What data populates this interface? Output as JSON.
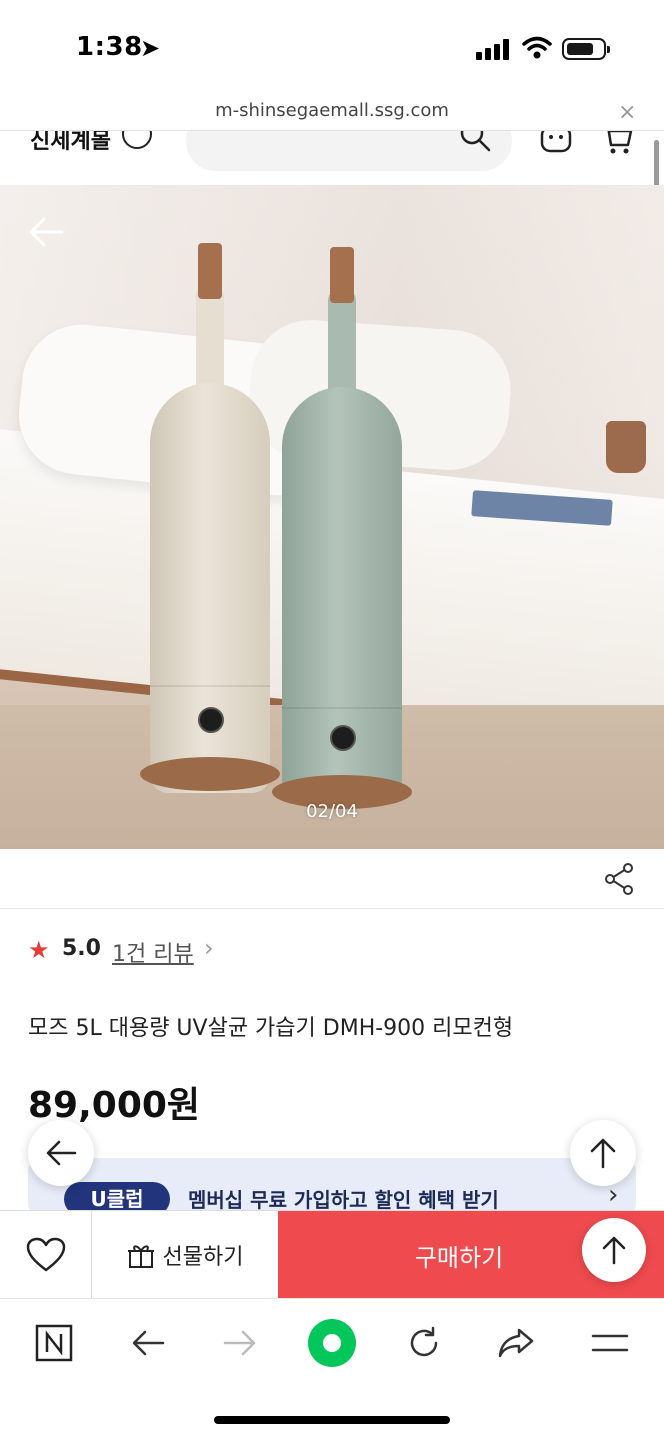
{
  "status_bar": {
    "time": "1:38"
  },
  "browser": {
    "url": "m-shinsegaemall.ssg.com",
    "close_label": "×"
  },
  "site_header": {
    "brand": "신세계몰"
  },
  "gallery": {
    "counter": "02/04"
  },
  "product": {
    "rating_star": "★",
    "rating": "5.0",
    "review_link": "1건 리뷰",
    "review_chevron": "›",
    "title": "모즈 5L 대용량 UV살균 가습기 DMH-900 리모컨형",
    "price": "89,000원"
  },
  "banner": {
    "badge": "U클럽",
    "text": "멤버십 무료 가입하고 할인 혜택 받기",
    "chevron": "›"
  },
  "purchase_bar": {
    "gift_label": "선물하기",
    "buy_label": "구매하기"
  },
  "colors": {
    "buy": "#ef4b4e",
    "star": "#e83b3b",
    "banner_bg": "#e7ecf8",
    "badge": "#21347c",
    "naver_green": "#03c75a"
  },
  "icons": [
    "back-arrow-icon",
    "search-icon",
    "chat-bot-icon",
    "cart-icon",
    "share-icon",
    "heart-icon",
    "gift-icon",
    "arrow-up-icon",
    "naver-n-icon",
    "forward-arrow-icon",
    "green-dot-icon",
    "reload-icon",
    "share-arrow-icon",
    "menu-icon"
  ]
}
